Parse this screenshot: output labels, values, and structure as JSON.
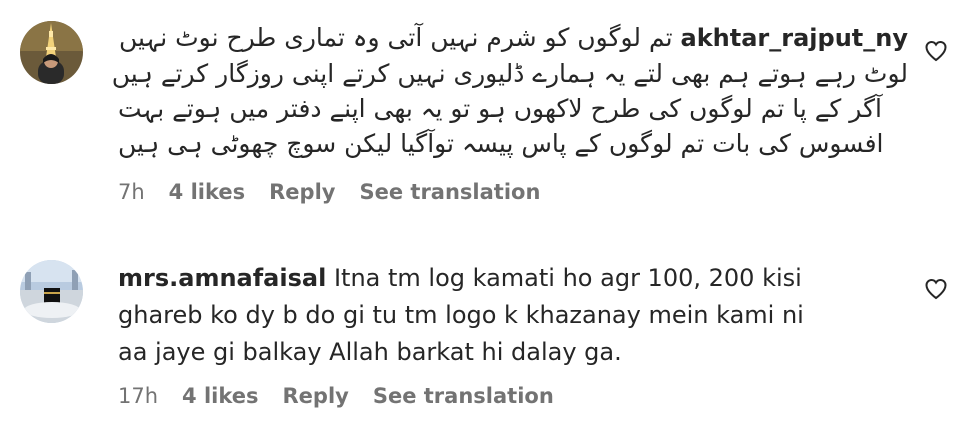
{
  "comments": [
    {
      "username": "akhtar_rajput_ny",
      "text_lines": [
        "تم لوگوں کو شرم نہیں آتی وہ تماری طرح نوٹ نہیں",
        "لوٹ رہے ہوتے ہم بھی لتے یہ ہمارے ڈلیوری نہیں کرتے اپنی روزگار کرتے ہیں",
        "آگر کے پا تم لوگوں کی طرح لاکھوں ہو تو یہ بھی اپنے دفتر میں ہوتے بہت",
        "افسوس کی بات تم لوگوں کے پاس پیسہ توآگیا لیکن سوچ چھوٹی ہی ہیں"
      ],
      "time": "7h",
      "likes": "4 likes",
      "reply": "Reply",
      "see_translation": "See translation",
      "avatar_icon": "eiffel-tower-avatar",
      "like_icon": "heart-outline-icon"
    },
    {
      "username": "mrs.amnafaisal",
      "text": "Itna tm log kamati ho agr 100, 200 kisi ghareb ko dy b do gi tu tm logo k khazanay mein kami ni aa jaye gi balkay Allah barkat hi dalay ga.",
      "time": "17h",
      "likes": "4 likes",
      "reply": "Reply",
      "see_translation": "See translation",
      "avatar_icon": "kaaba-avatar",
      "like_icon": "heart-outline-icon"
    }
  ],
  "colors": {
    "text": "#262626",
    "meta": "#737373",
    "background": "#ffffff"
  }
}
